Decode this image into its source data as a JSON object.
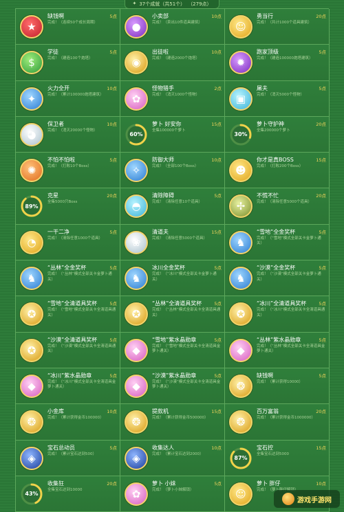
{
  "header": {
    "star_icon": "star-icon",
    "count_text": "37个成就（共51个）",
    "points_text": "（279点）"
  },
  "cells": [
    {
      "title": "缺钱啊",
      "points": "5点",
      "desc": "完成！（连续50个成长周期）",
      "icon": "star-icon",
      "color": "c-red",
      "glyph": "★"
    },
    {
      "title": "小卖部",
      "points": "10点",
      "desc": "完成！（卖出10件道具建筑）",
      "icon": "purple-orb-icon",
      "color": "c-purple",
      "glyph": "●"
    },
    {
      "title": "勇当行",
      "points": "20点",
      "desc": "完成！（共计1000个道具建筑）",
      "icon": "carrot-face-icon",
      "color": "c-yellow",
      "glyph": "☺"
    },
    {
      "title": "学徒",
      "points": "5点",
      "desc": "完成！（建造100个炮塔）",
      "icon": "green-coins-icon",
      "color": "c-green",
      "glyph": "$"
    },
    {
      "title": "出徒啦",
      "points": "10点",
      "desc": "完成！（建造2000个炮塔）",
      "icon": "gold-pot-icon",
      "color": "c-gold",
      "glyph": "◉"
    },
    {
      "title": "跑家顶级",
      "points": "5点",
      "desc": "完成！（建造100000炮塔建筑）",
      "icon": "spiky-monster-icon",
      "color": "c-purple",
      "glyph": "✹"
    },
    {
      "title": "火力全开",
      "points": "10点",
      "desc": "完成！（累计100000炮塔建筑）",
      "icon": "shield-fire-icon",
      "color": "c-blue",
      "glyph": "✦"
    },
    {
      "title": "怪物猎手",
      "points": "2点",
      "desc": "完成！（消灭1000个怪物）",
      "icon": "bunny-icon",
      "color": "c-pink",
      "glyph": "✿"
    },
    {
      "title": "屠夫",
      "points": "5点",
      "desc": "完成！（消灭5000个怪物）",
      "icon": "ice-block-icon",
      "color": "c-cyan",
      "glyph": "▣"
    },
    {
      "title": "保卫者",
      "points": "10点",
      "desc": "完成！（消灭20000个怪物）",
      "icon": "penguin-icon",
      "color": "c-white",
      "glyph": "◕"
    },
    {
      "title": "萝卜 好安你",
      "points": "15点",
      "desc": "全集100000个萝卜",
      "icon": "progress-ring",
      "progress": 60,
      "pct_text": "60%"
    },
    {
      "title": "萝卜守护神",
      "points": "20点",
      "desc": "全集200000个萝卜",
      "icon": "progress-ring",
      "progress": 30,
      "pct_text": "30%"
    },
    {
      "title": "不怕不怕啦",
      "points": "5点",
      "desc": "完成！（打败10个Boss）",
      "icon": "lion-monster-icon",
      "color": "c-orange",
      "glyph": "✺"
    },
    {
      "title": "防御大师",
      "points": "10点",
      "desc": "完成！（全部100个Boss）",
      "icon": "blue-flame-icon",
      "color": "c-blue",
      "glyph": "✧"
    },
    {
      "title": "你才是真BOSS",
      "points": "15点",
      "desc": "完成！（打败200个Boss）",
      "icon": "dog-boss-icon",
      "color": "c-yellow",
      "glyph": "☻"
    },
    {
      "title": "克星",
      "points": "20点",
      "desc": "全集5000只Boss",
      "icon": "progress-ring",
      "progress": 89,
      "pct_text": "89%"
    },
    {
      "title": "清除障碍",
      "points": "5点",
      "desc": "完成！（清除任意10个道具）",
      "icon": "igloo-icon",
      "color": "c-cyan",
      "glyph": "◓"
    },
    {
      "title": "不慌不忙",
      "points": "20点",
      "desc": "完成！（清除任意5000个道具）",
      "icon": "windmill-icon",
      "color": "c-olive",
      "glyph": "✢"
    },
    {
      "title": "一干二净",
      "points": "5点",
      "desc": "完成！（清除任意1000个道具）",
      "icon": "duck-icon",
      "color": "c-yellow",
      "glyph": "◔"
    },
    {
      "title": "清道夫",
      "points": "15点",
      "desc": "完成！（清除任意5000个道具）",
      "icon": "balloon-icon",
      "color": "c-white",
      "glyph": "❀"
    },
    {
      "title": "“雪地”全金奖杯",
      "points": "5点",
      "desc": "完成！（“雪地”模式全部关卡金萝卜通关）",
      "icon": "gold-carrot-icon",
      "color": "c-blue",
      "glyph": "♞"
    },
    {
      "title": "“丛林”全金奖杯",
      "points": "5点",
      "desc": "完成！（“丛林”模式全部关卡金萝卜通关）",
      "icon": "gold-carrot-icon",
      "color": "c-blue",
      "glyph": "♞"
    },
    {
      "title": "冰川全金奖杯",
      "points": "5点",
      "desc": "完成！（“冰川”模式全部关卡金萝卜通关）",
      "icon": "gold-carrot-icon",
      "color": "c-blue",
      "glyph": "♞"
    },
    {
      "title": "“沙漠”全金奖杯",
      "points": "5点",
      "desc": "完成！（“沙漠”模式全部关卡金萝卜通关）",
      "icon": "gold-carrot-icon",
      "color": "c-blue",
      "glyph": "♞"
    },
    {
      "title": "“雪地”全清道具奖杯",
      "points": "5点",
      "desc": "完成！（“雪地”模式全部关卡全清道具通关）",
      "icon": "gold-medal-icon",
      "color": "c-gold",
      "glyph": "✪"
    },
    {
      "title": "“丛林”全清道具奖杯",
      "points": "5点",
      "desc": "完成！（“丛林”模式全部关卡全清道具通关）",
      "icon": "gold-medal-icon",
      "color": "c-gold",
      "glyph": "✪"
    },
    {
      "title": "“冰川”全清道具奖杯",
      "points": "5点",
      "desc": "完成！（“冰川”模式全部关卡全清道具通关）",
      "icon": "gold-medal-icon",
      "color": "c-gold",
      "glyph": "✪"
    },
    {
      "title": "“沙漠”全清道具奖杯",
      "points": "5点",
      "desc": "完成！（“沙漠”模式全部关卡全清道具通关）",
      "icon": "gold-medal-icon",
      "color": "c-gold",
      "glyph": "✪"
    },
    {
      "title": "“雪地”紫水晶勋章",
      "points": "5点",
      "desc": "完成！（“雪地”模式全部关卡全清道具金萝卜通关）",
      "icon": "purple-crystal-icon",
      "color": "c-pink",
      "glyph": "◆"
    },
    {
      "title": "“丛林”紫水晶勋章",
      "points": "5点",
      "desc": "完成！（“丛林”模式全部关卡全清道具金萝卜通关）",
      "icon": "purple-crystal-icon",
      "color": "c-pink",
      "glyph": "◆"
    },
    {
      "title": "“冰川”紫水晶勋章",
      "points": "5点",
      "desc": "完成！（“冰川”模式全部关卡全清道具金萝卜通关）",
      "icon": "purple-crystal-icon",
      "color": "c-pink",
      "glyph": "◆"
    },
    {
      "title": "“沙漠”紫水晶勋章",
      "points": "5点",
      "desc": "完成！（“沙漠”模式全部关卡全清道具金萝卜通关）",
      "icon": "purple-crystal-icon",
      "color": "c-pink",
      "glyph": "◆"
    },
    {
      "title": "缺钱啊",
      "points": "5点",
      "desc": "完成！（累计获得10000）",
      "icon": "gold-coins-icon",
      "color": "c-gold",
      "glyph": "❂"
    },
    {
      "title": "小金库",
      "points": "10点",
      "desc": "完成！（累计获得金币100000）",
      "icon": "gold-coins-icon",
      "color": "c-gold",
      "glyph": "❂"
    },
    {
      "title": "提款机",
      "points": "15点",
      "desc": "完成！（累计获得金币500000）",
      "icon": "gold-coins-icon",
      "color": "c-gold",
      "glyph": "❂"
    },
    {
      "title": "百万富翁",
      "points": "20点",
      "desc": "完成！（累计获得金币1000000）",
      "icon": "gold-coins-icon",
      "color": "c-gold",
      "glyph": "❂"
    },
    {
      "title": "宝石总动员",
      "points": "5点",
      "desc": "完成！（累计宝石达到500）",
      "icon": "blue-gem-icon",
      "color": "c-navy",
      "glyph": "◈"
    },
    {
      "title": "收集达人",
      "points": "10点",
      "desc": "完成！（累计宝石达到2000）",
      "icon": "blue-gem-icon",
      "color": "c-navy",
      "glyph": "◈"
    },
    {
      "title": "宝石控",
      "points": "15点",
      "desc": "全集宝石达到5000",
      "icon": "progress-ring",
      "progress": 87,
      "pct_text": "87%"
    },
    {
      "title": "收集狂",
      "points": "20点",
      "desc": "全集宝石达到10000",
      "icon": "progress-ring",
      "progress": 43,
      "pct_text": "43%"
    },
    {
      "title": "萝卜 小妹",
      "points": "5点",
      "desc": "完成！（萝卜小妹解锁）",
      "icon": "pink-carrot-icon",
      "color": "c-pink",
      "glyph": "✿"
    },
    {
      "title": "萝卜 胖仔",
      "points": "10点",
      "desc": "完成！（萝卜胖仔解锁）",
      "icon": "green-carrot-icon",
      "color": "c-yellow",
      "glyph": "☺"
    }
  ],
  "watermark": {
    "text": "游戏手游网"
  }
}
